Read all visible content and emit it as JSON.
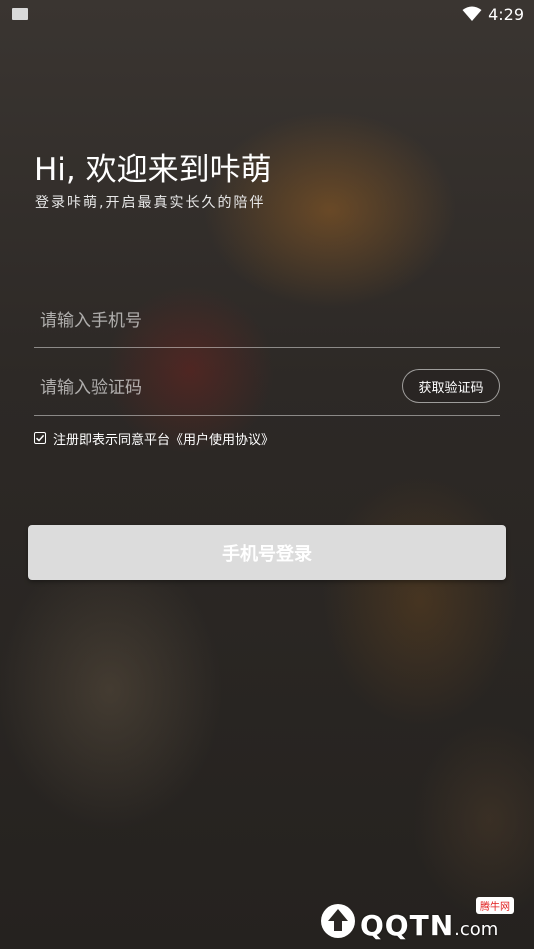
{
  "status_bar": {
    "time": "4:29"
  },
  "header": {
    "title": "Hi, 欢迎来到咔萌",
    "subtitle": "登录咔萌,开启最真实长久的陪伴"
  },
  "form": {
    "phone_placeholder": "请输入手机号",
    "code_placeholder": "请输入验证码",
    "get_code_label": "获取验证码",
    "agreement_text": "注册即表示同意平台《用户使用协议》",
    "agreement_checked": true
  },
  "login_button": {
    "label": "手机号登录"
  },
  "watermark": {
    "brand": "QQTN",
    "domain": ".com",
    "badge": "腾牛网"
  }
}
